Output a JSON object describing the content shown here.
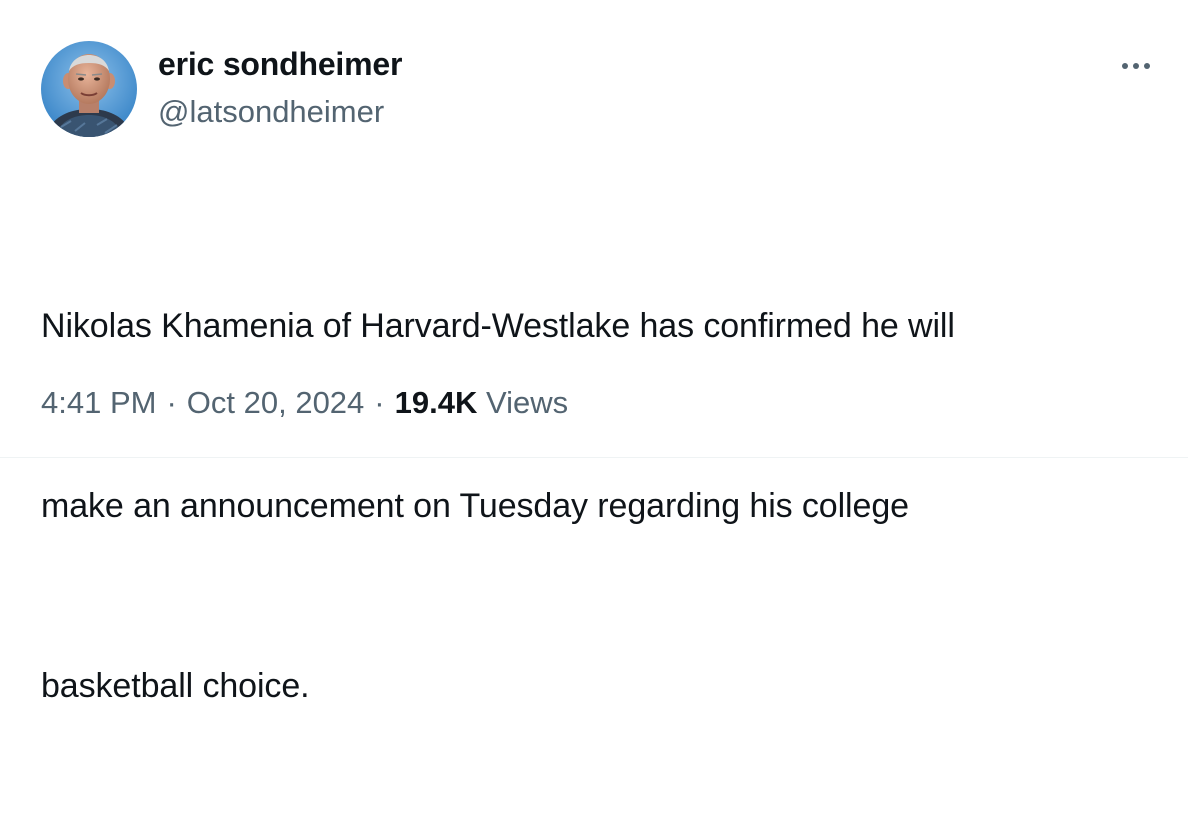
{
  "author": {
    "display_name": "eric sondheimer",
    "handle": "@latsondheimer"
  },
  "tweet": {
    "lines": [
      "Nikolas Khamenia of Harvard-Westlake has confirmed he will",
      "make an announcement on Tuesday regarding his college",
      "basketball choice."
    ]
  },
  "meta": {
    "time": "4:41 PM",
    "separator": "·",
    "date": "Oct 20, 2024",
    "views_count": "19.4K",
    "views_label": "Views"
  },
  "icons": {
    "more": "more-horizontal-icon"
  },
  "colors": {
    "primary_text": "#0f1419",
    "secondary_text": "#536471"
  }
}
